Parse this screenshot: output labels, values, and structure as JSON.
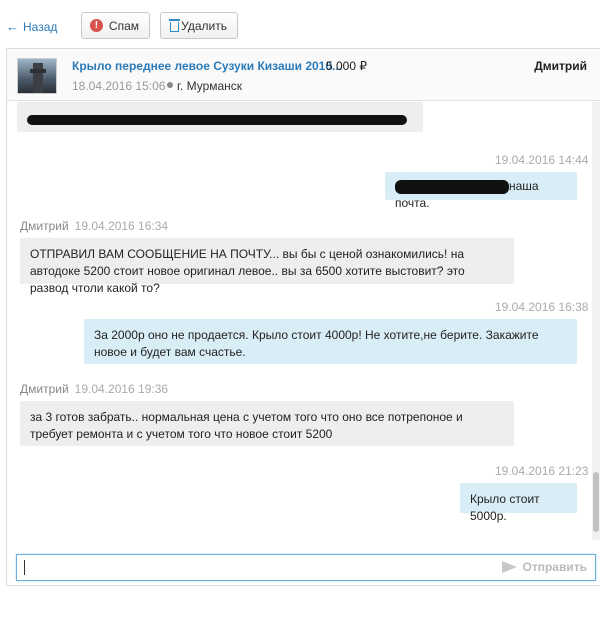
{
  "toolbar": {
    "back_label": "Назад",
    "spam_label": "Спам",
    "delete_label": "Удалить"
  },
  "ad": {
    "title": "Крыло переднее левое Сузуки Кизаши 2010...",
    "price": "5 000 ₽",
    "date": "18.04.2016 15:06",
    "city": "г. Мурманск",
    "seller": "Дмитрий"
  },
  "messages": [
    {
      "direction": "in",
      "author": "",
      "time": "",
      "text": "",
      "redacted": true
    },
    {
      "direction": "out",
      "author": "",
      "time": "19.04.2016 14:44",
      "text": "наша почта.",
      "redacted": true
    },
    {
      "direction": "in",
      "author": "Дмитрий",
      "time": "19.04.2016 16:34",
      "text": "ОТПРАВИЛ ВАМ СООБЩЕНИЕ НА ПОЧТУ...  вы бы с ценой ознакомились! на автодоке 5200 стоит новое оригинал левое.. вы за 6500 хотите выстовит? это развод чтоли какой то?"
    },
    {
      "direction": "out",
      "author": "",
      "time": "19.04.2016 16:38",
      "text": "За 2000р оно не продается. Крыло стоит 4000р! Не хотите,не берите. Закажите новое и будет вам счастье."
    },
    {
      "direction": "in",
      "author": "Дмитрий",
      "time": "19.04.2016 19:36",
      "text": "за 3 готов забрать.. нормальная цена с учетом того что оно все потрепоное и требует ремонта и с учетом того что новое стоит 5200"
    },
    {
      "direction": "out",
      "author": "",
      "time": "19.04.2016 21:23",
      "text": "Крыло стоит 5000р."
    }
  ],
  "compose": {
    "value": "",
    "send_label": "Отправить"
  },
  "colors": {
    "link": "#2b7bb9",
    "incoming_bubble": "#eeeeee",
    "outgoing_bubble": "#d9edf7",
    "spam_icon": "#d9534f",
    "trash_icon": "#2e8bc9"
  },
  "icons": {
    "back": "left-arrow-icon",
    "spam": "exclamation-circle-icon",
    "delete": "trash-icon",
    "city": "map-pin-icon",
    "send": "paper-plane-icon"
  }
}
